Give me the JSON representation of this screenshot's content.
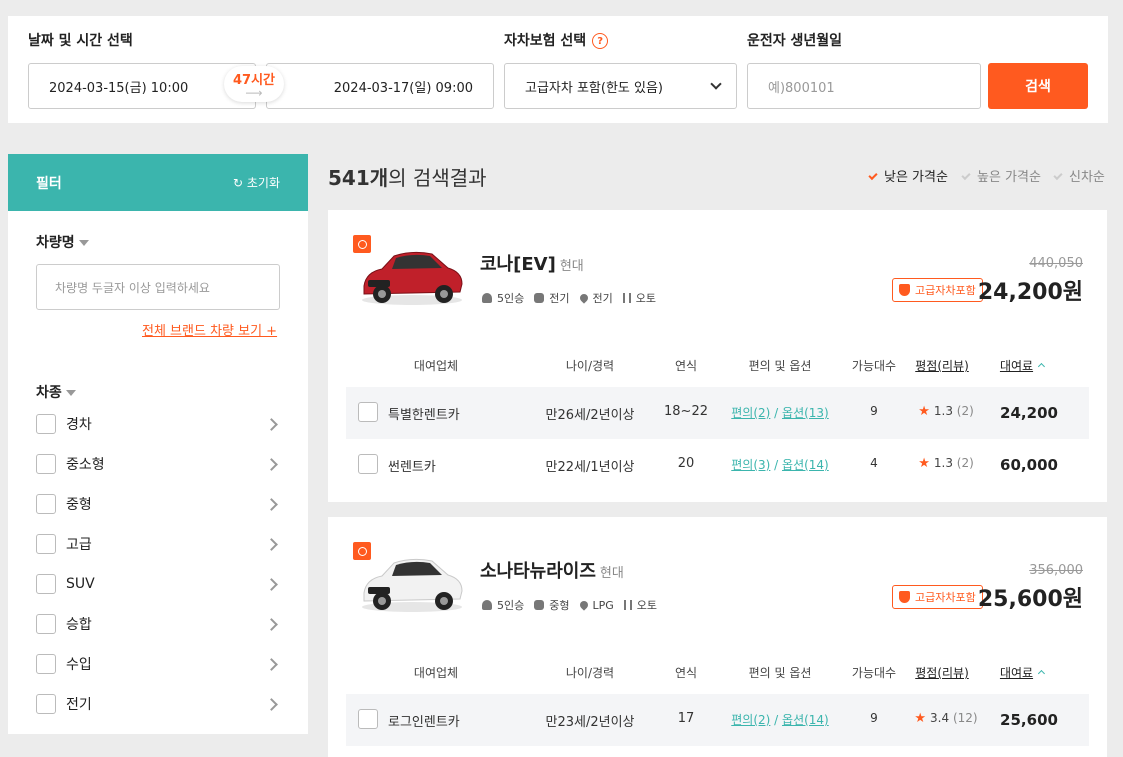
{
  "search": {
    "date_label": "날짜 및 시간 선택",
    "start_datetime": "2024-03-15(금) 10:00",
    "duration": "47시간",
    "end_datetime": "2024-03-17(일) 09:00",
    "insurance_label": "자차보험 선택",
    "insurance_value": "고급자차 포함(한도 있음)",
    "birth_label": "운전자 생년월일",
    "birth_placeholder": "예)800101",
    "search_button": "검색"
  },
  "filter": {
    "title": "필터",
    "reset": "초기화",
    "car_name_title": "차량명",
    "car_name_placeholder": "차량명 두글자 이상 입력하세요",
    "all_brands_link": "전체 브랜드 차량 보기 +",
    "car_type_title": "차종",
    "car_types": [
      "경차",
      "중소형",
      "중형",
      "고급",
      "SUV",
      "승합",
      "수입",
      "전기"
    ]
  },
  "results": {
    "count": "541개",
    "count_suffix": "의 검색결과",
    "sort_options": [
      "낮은 가격순",
      "높은 가격순",
      "신차순"
    ],
    "active_sort": "낮은 가격순",
    "table_headers": {
      "company": "대여업체",
      "age": "나이/경력",
      "year": "연식",
      "options": "편의 및 옵션",
      "available": "가능대수",
      "rating": "평점(리뷰)",
      "fee": "대여료"
    },
    "cars": [
      {
        "name": "코나[EV]",
        "maker": "현대",
        "seats": "5인승",
        "class": "전기",
        "fuel": "전기",
        "transmission": "오토",
        "original_price": "440,050",
        "insurance_badge": "고급자차포함",
        "price": "24,200원",
        "color": "#c0202a",
        "rows": [
          {
            "company": "특별한렌트카",
            "age": "만26세/2년이상",
            "year": "18~22",
            "conv": "편의(2)",
            "opt": "옵션(13)",
            "available": "9",
            "rating": "1.3",
            "reviews": "(2)",
            "fee": "24,200"
          },
          {
            "company": "썬렌트카",
            "age": "만22세/1년이상",
            "year": "20",
            "conv": "편의(3)",
            "opt": "옵션(14)",
            "available": "4",
            "rating": "1.3",
            "reviews": "(2)",
            "fee": "60,000"
          }
        ]
      },
      {
        "name": "소나타뉴라이즈",
        "maker": "현대",
        "seats": "5인승",
        "class": "중형",
        "fuel": "LPG",
        "transmission": "오토",
        "original_price": "356,000",
        "insurance_badge": "고급자차포함",
        "price": "25,600원",
        "color": "#f2f2f2",
        "rows": [
          {
            "company": "로그인렌트카",
            "age": "만23세/2년이상",
            "year": "17",
            "conv": "편의(2)",
            "opt": "옵션(14)",
            "available": "9",
            "rating": "3.4",
            "reviews": "(12)",
            "fee": "25,600"
          }
        ]
      }
    ]
  }
}
